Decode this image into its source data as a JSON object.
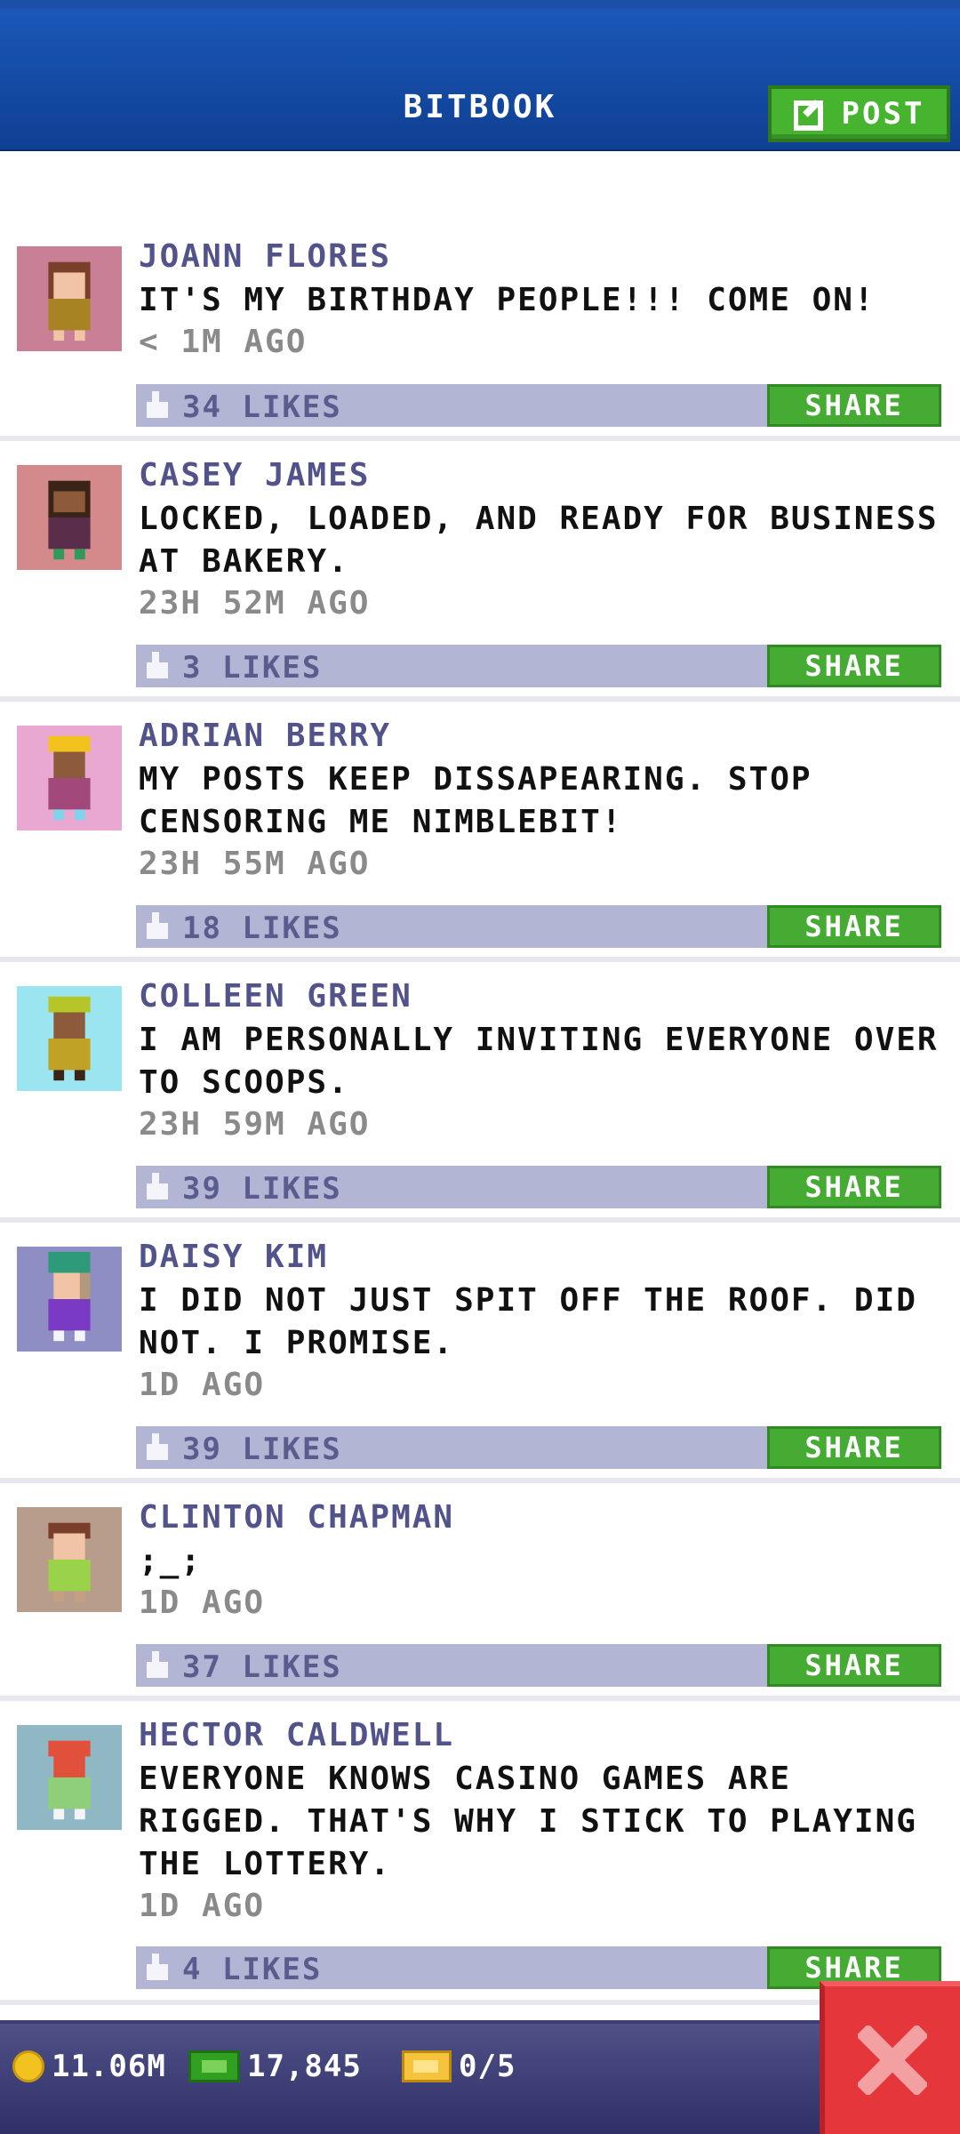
{
  "header": {
    "title": "BITBOOK",
    "post_label": "POST"
  },
  "posts": [
    {
      "name": "JOANN FLORES",
      "text": "IT'S MY BIRTHDAY PEOPLE!!! COME ON!",
      "time": "< 1M AGO",
      "likes": "34 LIKES",
      "share": "SHARE",
      "avatar_bg": "#c97f95"
    },
    {
      "name": "CASEY JAMES",
      "text": "LOCKED, LOADED, AND READY FOR BUSINESS AT BAKERY.",
      "time": "23H 52M AGO",
      "likes": "3 LIKES",
      "share": "SHARE",
      "avatar_bg": "#d4898a"
    },
    {
      "name": "ADRIAN BERRY",
      "text": "MY POSTS KEEP DISSAPEARING. STOP CENSORING ME NIMBLEBIT!",
      "time": "23H 55M AGO",
      "likes": "18 LIKES",
      "share": "SHARE",
      "avatar_bg": "#e9a8d2"
    },
    {
      "name": "COLLEEN GREEN",
      "text": "I AM PERSONALLY INVITING EVERYONE OVER TO SCOOPS.",
      "time": "23H 59M AGO",
      "likes": "39 LIKES",
      "share": "SHARE",
      "avatar_bg": "#9be5f0"
    },
    {
      "name": "DAISY KIM",
      "text": "I DID NOT JUST SPIT OFF THE ROOF. DID NOT. I PROMISE.",
      "time": "1D AGO",
      "likes": "39 LIKES",
      "share": "SHARE",
      "avatar_bg": "#8e8ec4"
    },
    {
      "name": "CLINTON CHAPMAN",
      "text": ";_;",
      "time": "1D AGO",
      "likes": "37 LIKES",
      "share": "SHARE",
      "avatar_bg": "#b99d8c"
    },
    {
      "name": "HECTOR CALDWELL",
      "text": "EVERYONE KNOWS CASINO GAMES ARE RIGGED. THAT'S WHY I STICK TO PLAYING THE LOTTERY.",
      "time": "1D AGO",
      "likes": "4 LIKES",
      "share": "SHARE",
      "avatar_bg": "#8fb8c4"
    }
  ],
  "bottom": {
    "coins": "11.06M",
    "cash": "17,845",
    "tickets": "0/5"
  },
  "colors": {
    "accent_green": "#47b42f",
    "header_blue": "#1a58b8",
    "close_red": "#e5363c"
  },
  "icons": [
    "edit-icon",
    "thumbs-up-icon",
    "coin-icon",
    "cash-icon",
    "ticket-icon",
    "close-icon"
  ]
}
